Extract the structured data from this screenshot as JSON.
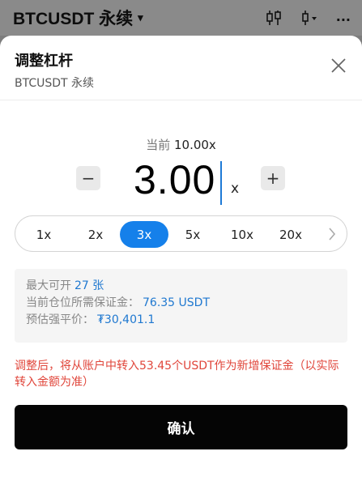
{
  "topbar": {
    "pair": "BTCUSDT 永续",
    "caret": "▾",
    "icons": [
      "candlestick-icon",
      "indicator-icon",
      "more-icon"
    ],
    "more": "···"
  },
  "sheet": {
    "title": "调整杠杆",
    "subtitle": "BTCUSDT 永续"
  },
  "leverage": {
    "current_label": "当前",
    "current_value": "10.00x",
    "value": "3.00",
    "unit": "x",
    "minus": "−",
    "plus": "+"
  },
  "presets": {
    "options": [
      "1x",
      "2x",
      "3x",
      "5x",
      "10x",
      "20x"
    ],
    "selected": "3x"
  },
  "info": {
    "max_open_label": "最大可开",
    "max_open_value": "27 张",
    "margin_label": "当前仓位所需保证金：",
    "margin_value": "76.35 USDT",
    "liq_label": "预估强平价：",
    "liq_value": "₮30,401.1"
  },
  "warning": "调整后，将从账户中转入53.45个USDT作为新增保证金（以实际转入金额为准）",
  "confirm_label": "确认",
  "colors": {
    "accent": "#1580ea",
    "warning": "#e0453a",
    "button": "#050505"
  }
}
